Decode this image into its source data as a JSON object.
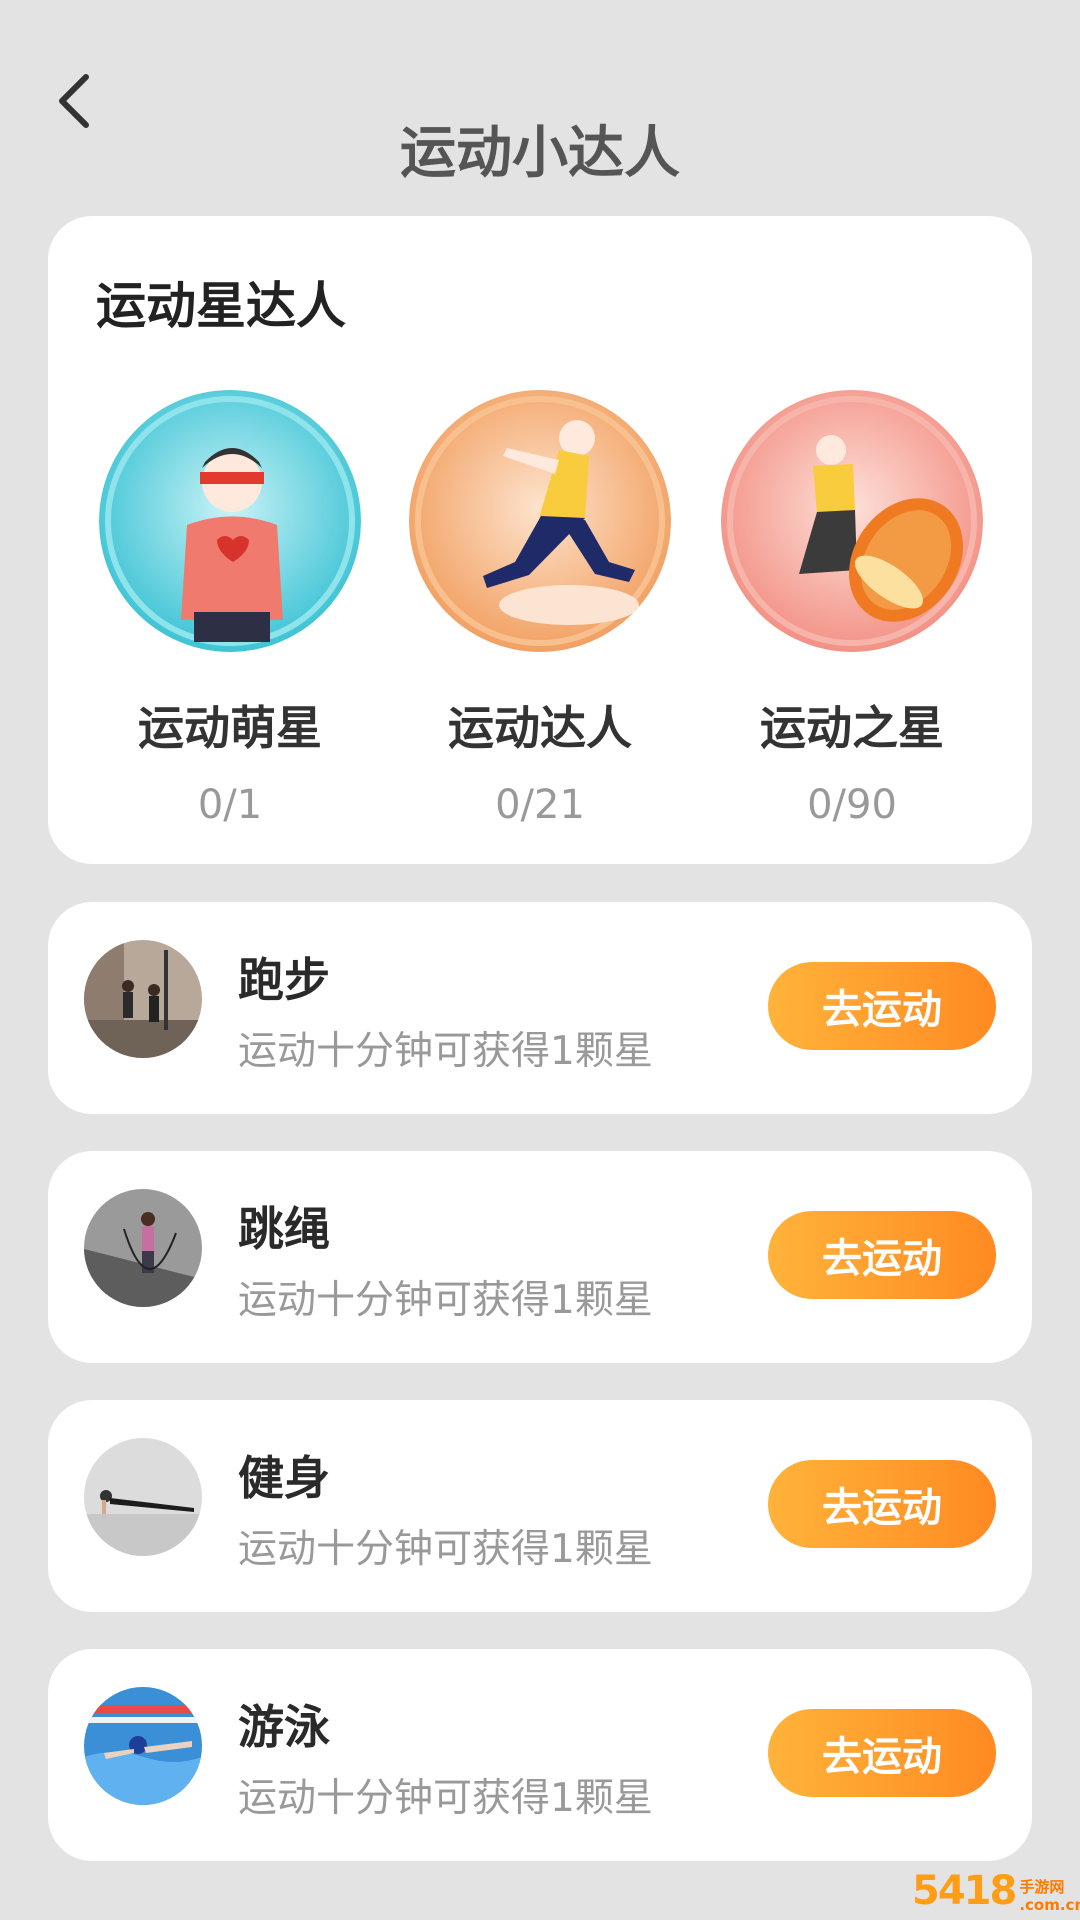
{
  "header": {
    "title": "运动小达人",
    "back_icon": "chevron-left-icon"
  },
  "achievements": {
    "heading": "运动星达人",
    "badges": [
      {
        "name": "运动萌星",
        "progress": "0/1",
        "color": "#4fc8d8"
      },
      {
        "name": "运动达人",
        "progress": "0/21",
        "color": "#f6a15a"
      },
      {
        "name": "运动之星",
        "progress": "0/90",
        "color": "#f39a8e"
      }
    ]
  },
  "sports": [
    {
      "name": "跑步",
      "desc": "运动十分钟可获得1颗星",
      "button": "去运动"
    },
    {
      "name": "跳绳",
      "desc": "运动十分钟可获得1颗星",
      "button": "去运动"
    },
    {
      "name": "健身",
      "desc": "运动十分钟可获得1颗星",
      "button": "去运动"
    },
    {
      "name": "游泳",
      "desc": "运动十分钟可获得1颗星",
      "button": "去运动"
    }
  ],
  "watermark": {
    "digits": "5418",
    "line1": "手游网",
    "line2": ".com.cn"
  },
  "colors": {
    "accent_start": "#ffb33a",
    "accent_end": "#ff8a22",
    "background": "#e3e3e3"
  }
}
